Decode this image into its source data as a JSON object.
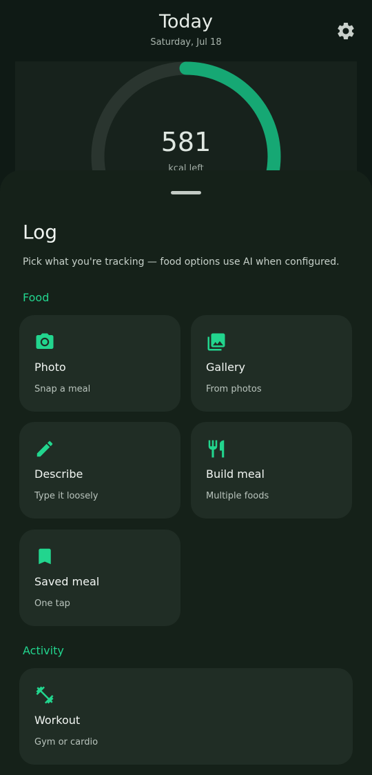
{
  "header": {
    "title": "Today",
    "date": "Saturday, Jul 18",
    "settings_icon": "gear-icon"
  },
  "summary": {
    "kcal_left": "581",
    "kcal_label": "kcal left",
    "progress_fraction": 0.62,
    "colors": {
      "track": "#2a352f",
      "progress": "#16a874"
    }
  },
  "sheet": {
    "title": "Log",
    "subtitle": "Pick what you're tracking — food options use AI when configured.",
    "food_section": "Food",
    "activity_section": "Activity",
    "accent": "#22d58e",
    "food_options": [
      {
        "label": "Photo",
        "desc": "Snap a meal",
        "icon": "camera-icon"
      },
      {
        "label": "Gallery",
        "desc": "From photos",
        "icon": "gallery-icon"
      },
      {
        "label": "Describe",
        "desc": "Type it loosely",
        "icon": "pencil-icon"
      },
      {
        "label": "Build meal",
        "desc": "Multiple foods",
        "icon": "utensils-icon"
      },
      {
        "label": "Saved meal",
        "desc": "One tap",
        "icon": "bookmark-icon"
      }
    ],
    "activity_options": [
      {
        "label": "Workout",
        "desc": "Gym or cardio",
        "icon": "dumbbell-icon"
      }
    ]
  }
}
